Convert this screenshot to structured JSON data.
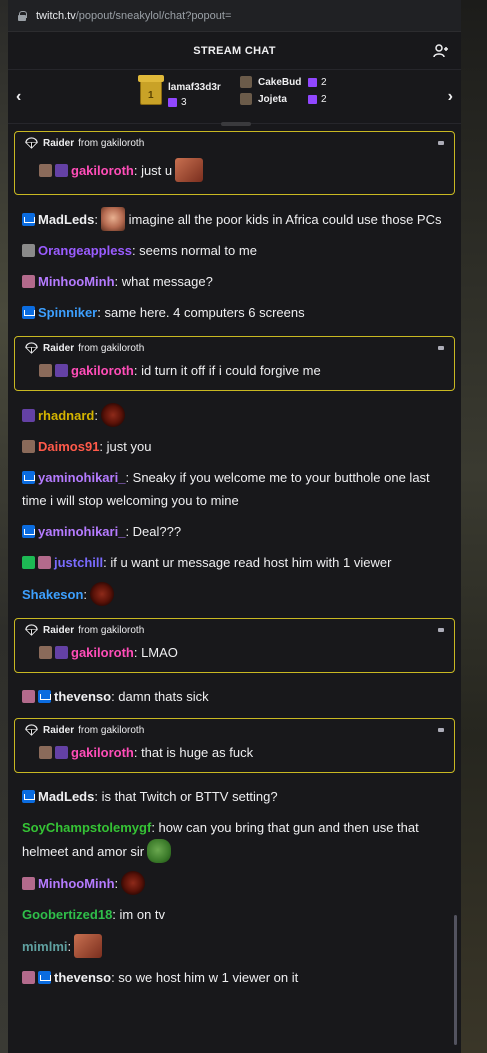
{
  "browser": {
    "domain": "twitch.tv",
    "path": "/popout/sneakylol/chat?popout="
  },
  "header": {
    "title": "STREAM CHAT"
  },
  "gifts": {
    "top": [
      {
        "name": "lamaf33d3r",
        "count": "3"
      },
      {
        "name": "CakeBud",
        "count": "2"
      },
      {
        "name": "Jojeta",
        "count": "2"
      }
    ]
  },
  "raid_label": {
    "title": "Raider",
    "from": "from gakiloroth"
  },
  "messages": {
    "r1": {
      "user": "gakiloroth",
      "text": ": just u"
    },
    "m1": {
      "user": "MadLeds",
      "text": "imagine all the poor kids in Africa could use those PCs"
    },
    "m2": {
      "user": "Orangeappless",
      "text": ": seems normal to me"
    },
    "m3": {
      "user": "MinhooMinh",
      "text": ": what message?"
    },
    "m4": {
      "user": "Spinniker",
      "text": ": same here. 4 computers 6 screens"
    },
    "r2": {
      "user": "gakiloroth",
      "text": ": id turn it off if i could forgive me"
    },
    "m5": {
      "user": "rhadnard",
      "text": ":"
    },
    "m6": {
      "user": "Daimos91",
      "text": ": just you"
    },
    "m7": {
      "user": "yaminohikari_",
      "text": ": Sneaky if you welcome me to your butthole one last time i will stop welcoming you to mine"
    },
    "m8": {
      "user": "yaminohikari_",
      "text": ": Deal???"
    },
    "m9": {
      "user": "justchill",
      "text": ": if u want ur message read host him with 1 viewer"
    },
    "m10": {
      "user": "Shakeson",
      "text": ":"
    },
    "r3": {
      "user": "gakiloroth",
      "text": ": LMAO"
    },
    "m11": {
      "user": "thevenso",
      "text": ": damn thats sick"
    },
    "r4": {
      "user": "gakiloroth",
      "text": ": that is huge as fuck"
    },
    "m12": {
      "user": "MadLeds",
      "text": ": is that Twitch or BTTV setting?"
    },
    "m13": {
      "user": "SoyChampstolemygf",
      "text": ": how can you bring that gun and then use that helmeet and amor sir"
    },
    "m14": {
      "user": "MinhooMinh",
      "text": ":"
    },
    "m15": {
      "user": "Goobertized18",
      "text": ": im on tv"
    },
    "m16": {
      "user": "mimlmi",
      "text": ":"
    },
    "m17": {
      "user": "thevenso",
      "text": ": so we host him w 1 viewer on it"
    }
  },
  "colors": {
    "raid_border": "#c8b822",
    "gakiloroth": "#ff4db8",
    "MadLeds": "#efeff1",
    "Orangeappless": "#9a5cff",
    "MinhooMinh": "#b57bff",
    "Spinniker": "#3da0ff",
    "rhadnard": "#d4b400",
    "Daimos91": "#ff5a4a",
    "yaminohikari_": "#b57bff",
    "justchill": "#7a6bff",
    "Shakeson": "#3da0ff",
    "thevenso": "#efeff1",
    "SoyChampstolemygf": "#35c335",
    "Goobertized18": "#2fbf4a",
    "mimlmi": "#5fa0a0"
  }
}
